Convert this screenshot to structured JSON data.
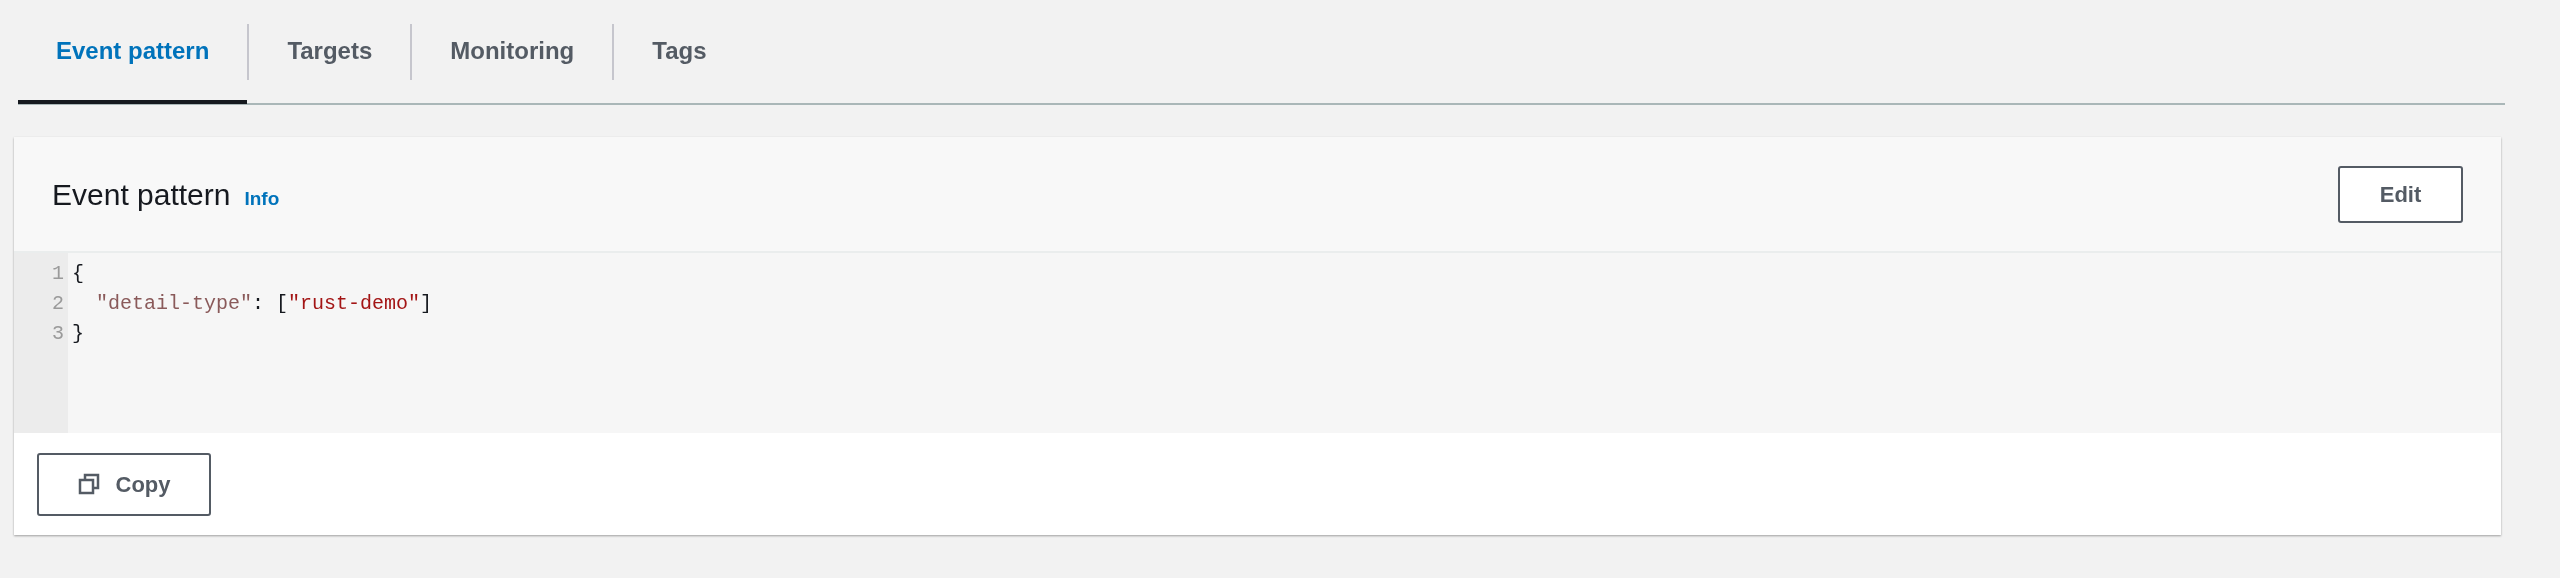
{
  "tabs": [
    {
      "label": "Event pattern",
      "selected": true
    },
    {
      "label": "Targets",
      "selected": false
    },
    {
      "label": "Monitoring",
      "selected": false
    },
    {
      "label": "Tags",
      "selected": false
    }
  ],
  "panel": {
    "title": "Event pattern",
    "info_link": "Info",
    "edit_button": "Edit",
    "code": [
      {
        "number": "1",
        "indented": false,
        "tokens": [
          {
            "kind": "punct",
            "text": "{"
          }
        ]
      },
      {
        "number": "2",
        "indented": true,
        "tokens": [
          {
            "kind": "key",
            "text": "\"detail-type\""
          },
          {
            "kind": "punct",
            "text": ": ["
          },
          {
            "kind": "string",
            "text": "\"rust-demo\""
          },
          {
            "kind": "punct",
            "text": "]"
          }
        ]
      },
      {
        "number": "3",
        "indented": false,
        "tokens": [
          {
            "kind": "punct",
            "text": "}"
          }
        ]
      }
    ],
    "copy_button": "Copy"
  }
}
